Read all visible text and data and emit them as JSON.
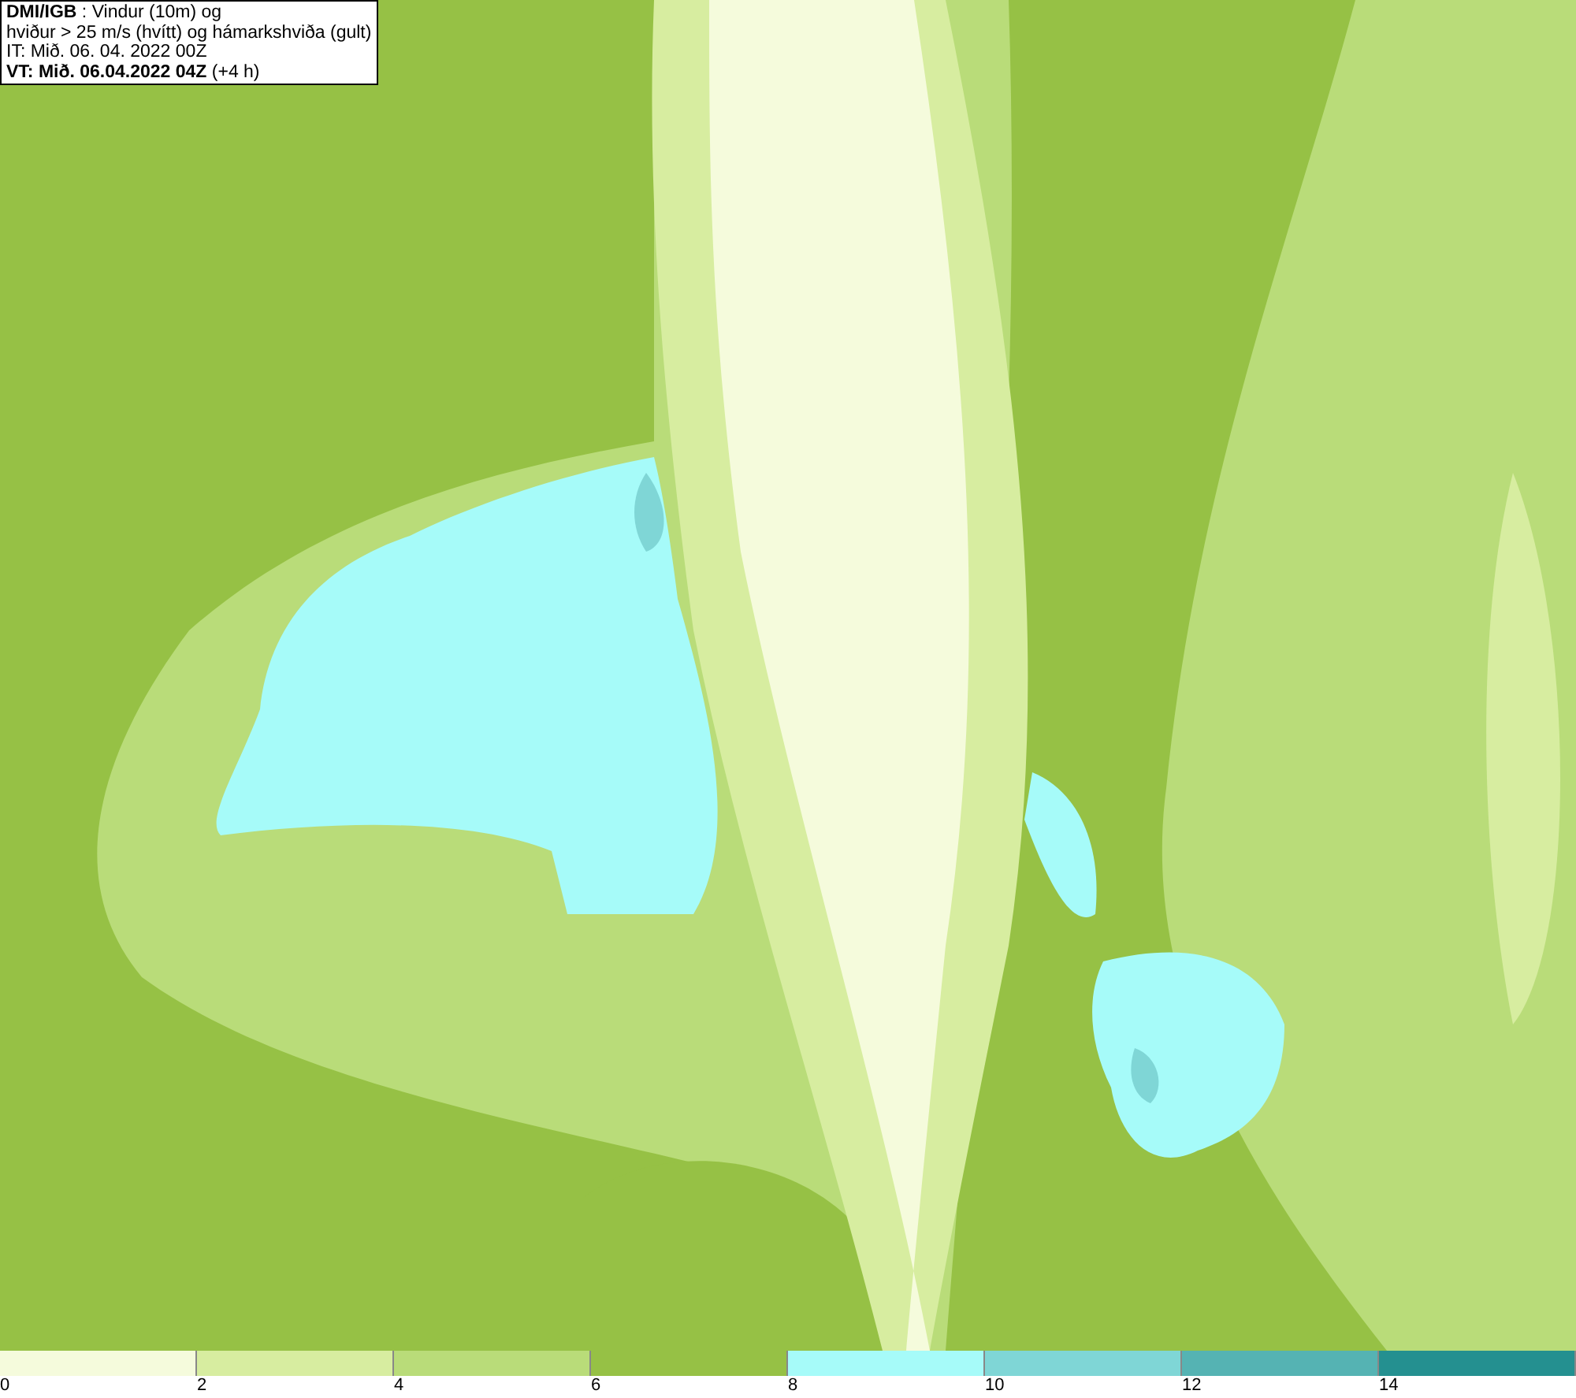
{
  "info_box": {
    "lines": [
      "**DMI/IGB** : Vindur (10m) og",
      "hviður > 25 m/s (hvítt) og hámarkshviða (gult)",
      "IT: Mið. 06. 04. 2022 00Z",
      "**VT: Mið. 06.04.2022 04Z** (+4 h)"
    ]
  },
  "legend": {
    "bins": [
      {
        "color": "#f5fbdc"
      },
      {
        "color": "#d7eda0"
      },
      {
        "color": "#b9dc79"
      },
      {
        "color": "#96c145"
      },
      {
        "color": "#a6fbf9"
      },
      {
        "color": "#7fd6d6"
      },
      {
        "color": "#55b3b3"
      },
      {
        "color": "#249090"
      }
    ],
    "labels": [
      "0",
      "2",
      "4",
      "6",
      "8",
      "10",
      "12",
      "14"
    ]
  }
}
